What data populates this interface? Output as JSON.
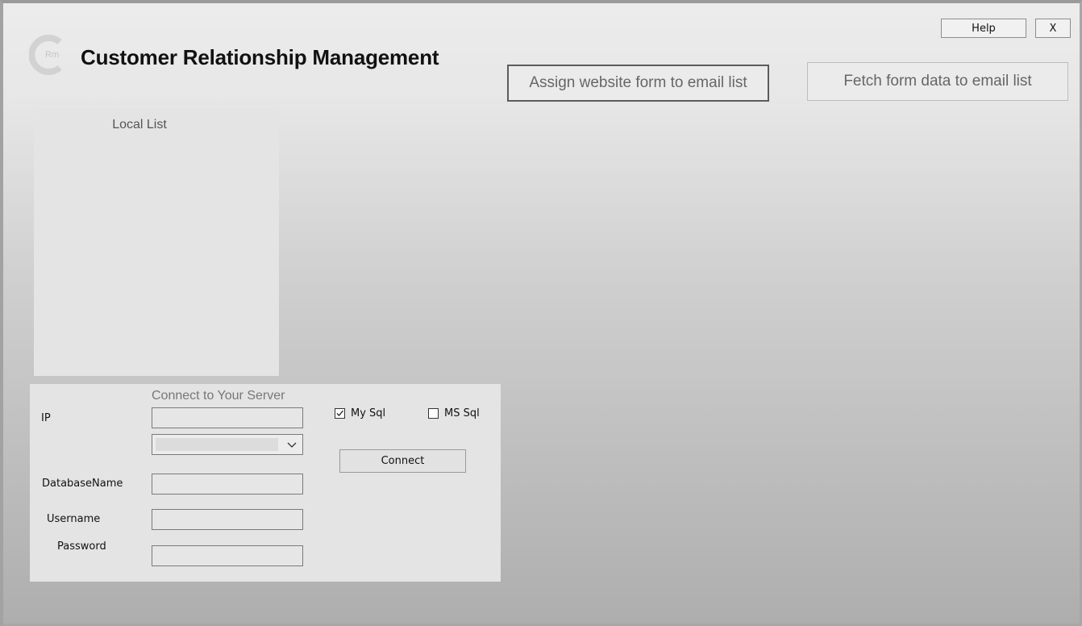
{
  "header": {
    "logo_text": "Rm",
    "title": "Customer Relationship Management",
    "help_label": "Help",
    "close_label": "X"
  },
  "actions": {
    "assign_label": "Assign website form to email list",
    "fetch_label": "Fetch form data to email list"
  },
  "local_list": {
    "title": "Local List"
  },
  "server": {
    "title": "Connect to Your Server",
    "labels": {
      "ip": "IP",
      "database_name": "DatabaseName",
      "username": "Username",
      "password": "Password"
    },
    "values": {
      "ip": "",
      "server_select": "",
      "database_name": "",
      "username": "",
      "password": ""
    },
    "db_types": [
      {
        "label": "My Sql",
        "checked": true
      },
      {
        "label": "MS Sql",
        "checked": false
      }
    ],
    "connect_label": "Connect"
  }
}
